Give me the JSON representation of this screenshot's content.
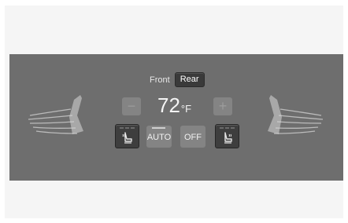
{
  "zone_toggle": {
    "front_label": "Front",
    "rear_label": "Rear",
    "selected": "Rear"
  },
  "temperature": {
    "value": "72",
    "unit": "°F",
    "decrease_symbol": "−",
    "increase_symbol": "+"
  },
  "buttons": {
    "auto_label": "AUTO",
    "off_label": "OFF"
  },
  "icons": {
    "left_seat": "seat-heater-left-icon",
    "right_seat": "seat-heater-right-icon",
    "left_airflow": "left-seat-airflow-icon",
    "right_airflow": "right-seat-airflow-icon"
  },
  "colors": {
    "panel": "#6e6e6e",
    "selected_button": "#3a3a3a",
    "disabled_button": "#848484",
    "text": "#f4f4f4"
  }
}
